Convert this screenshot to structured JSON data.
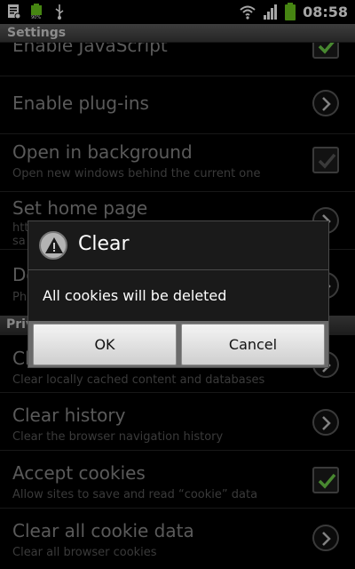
{
  "status_bar": {
    "time": "08:58",
    "left_icons": [
      "notes-icon",
      "battery-mon-icon",
      "usb-icon"
    ],
    "right_icons": [
      "wifi-icon",
      "signal-icon",
      "battery-icon"
    ],
    "battery_color": "#6ccc1c"
  },
  "header": {
    "title": "Settings"
  },
  "settings": {
    "enable_javascript": {
      "title": "Enable JavaScript",
      "checked": true
    },
    "enable_plugins": {
      "title": "Enable plug-ins"
    },
    "open_background": {
      "title": "Open in background",
      "summary": "Open new windows behind the current one",
      "checked": false
    },
    "home_page": {
      "title": "Set home page",
      "summary_partial_1": "htt",
      "summary_partial_2": "sa"
    },
    "downloads_partial": {
      "title": "Do",
      "summary": "Ph"
    }
  },
  "privacy": {
    "header_partial": "Priv",
    "clear_cache": {
      "title_partial": "Cl",
      "summary": "Clear locally cached content and databases"
    },
    "clear_history": {
      "title": "Clear history",
      "summary": "Clear the browser navigation history"
    },
    "accept_cookies": {
      "title": "Accept cookies",
      "summary": "Allow sites to save and read “cookie” data",
      "checked": true
    },
    "clear_cookies": {
      "title": "Clear all cookie data",
      "summary": "Clear all browser cookies"
    }
  },
  "dialog": {
    "title": "Clear",
    "message": "All cookies will be deleted",
    "ok_label": "OK",
    "cancel_label": "Cancel",
    "icon": "warning-icon"
  },
  "colors": {
    "check_green": "#6fd24a"
  }
}
